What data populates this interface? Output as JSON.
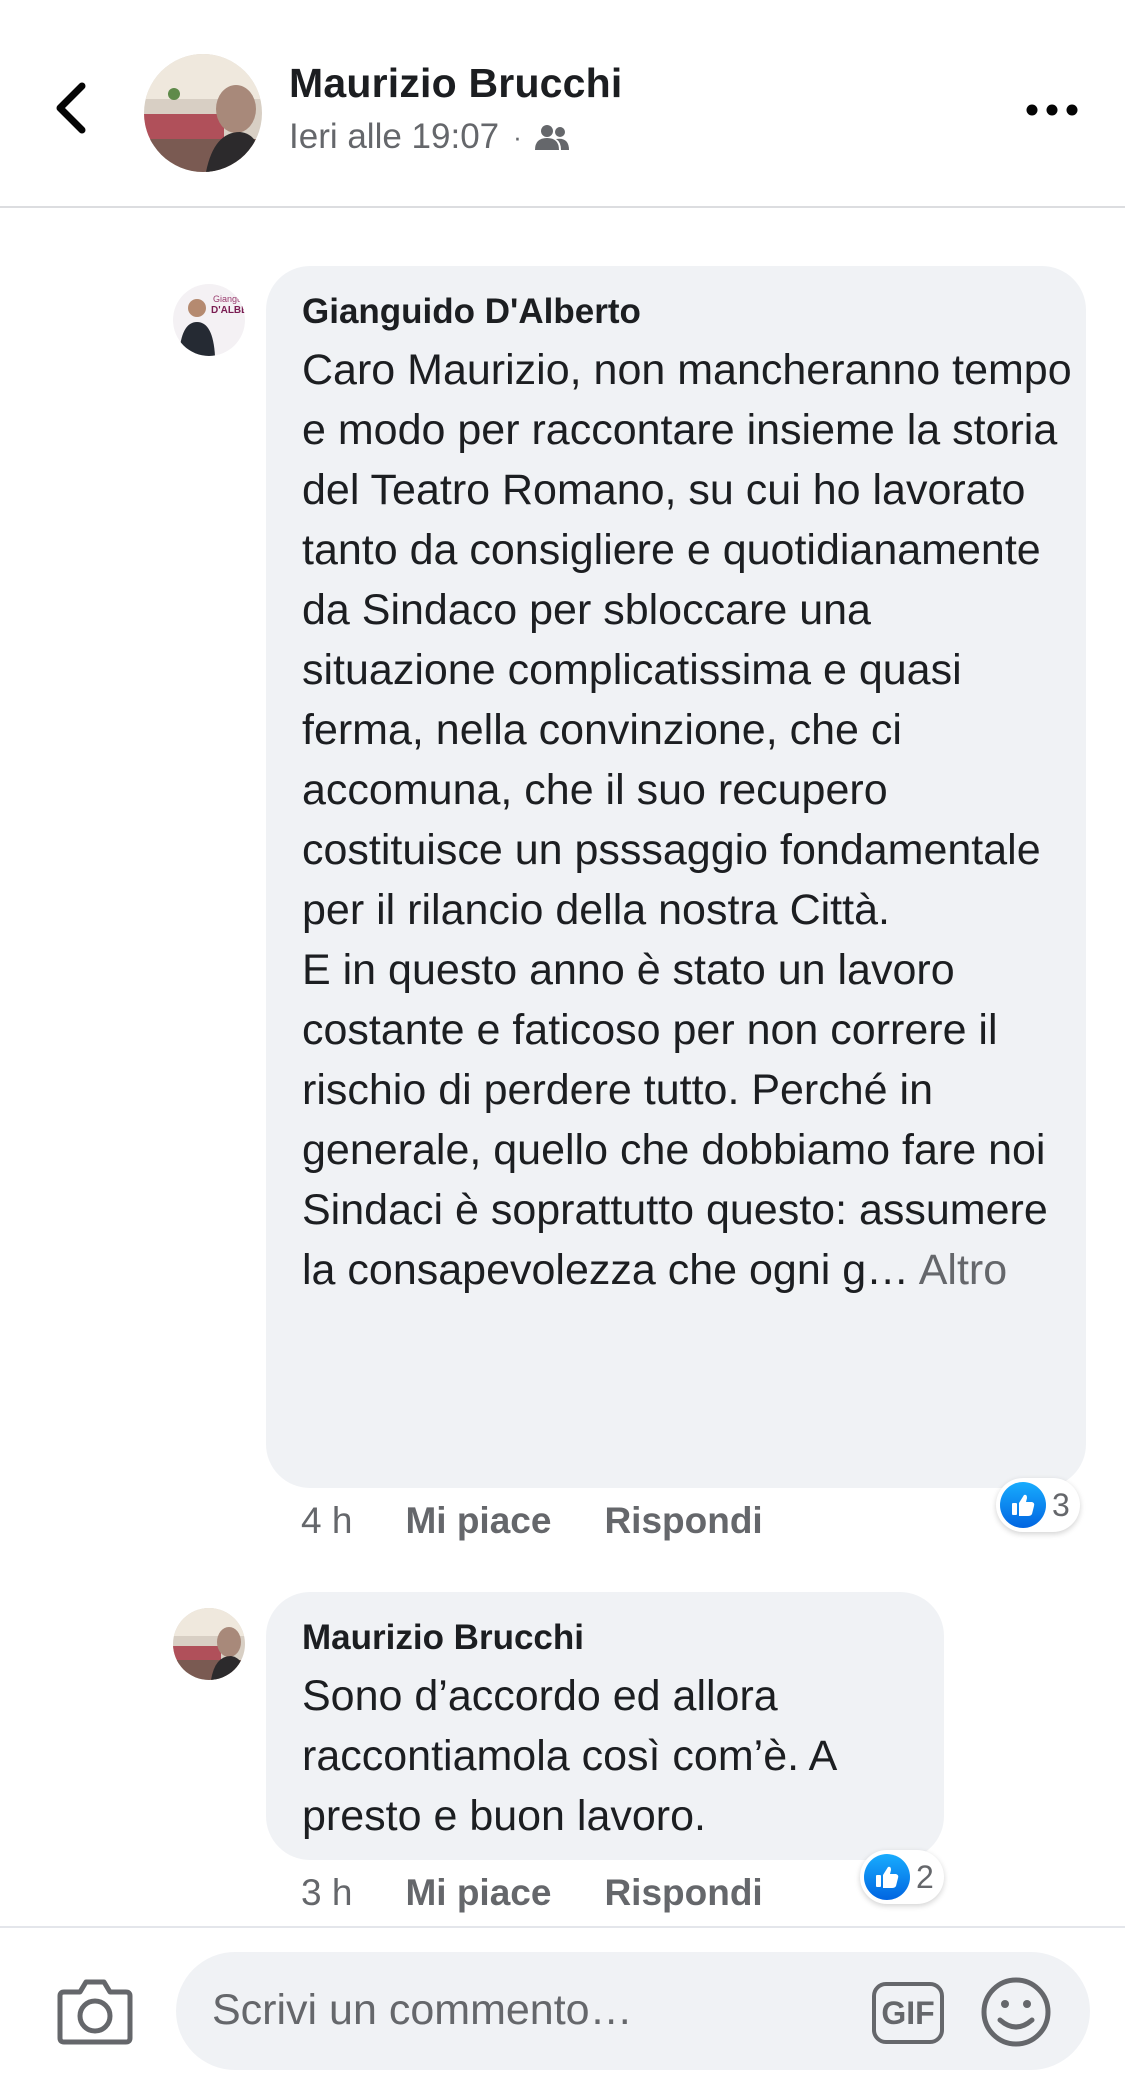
{
  "header": {
    "author_name": "Maurizio Brucchi",
    "timestamp": "Ieri alle 19:07",
    "separator": "·",
    "audience_icon": "friends-icon",
    "back_icon": "chevron-left-icon",
    "more_icon": "more-horizontal-icon"
  },
  "comments": [
    {
      "author": "Gianguido D'Alberto",
      "text": "Caro Maurizio, non mancheranno tempo e modo per raccontare insieme la storia del Teatro Romano, su cui ho lavorato tanto da consigliere e quotidianamente da Sindaco per sbloccare una situazione complicatissima e quasi ferma, nella convinzione, che ci accomuna, che il suo recupero costituisce un psssaggio fondamentale per il rilancio della nostra Città.\nE in questo anno è stato un lavoro costante e faticoso per non correre il rischio di perdere tutto. Perché in generale, quello che dobbiamo fare noi Sindaci è soprattutto questo: assumere la consapevolezza che ogni g…",
      "more_label": "Altro",
      "time": "4 h",
      "like_label": "Mi piace",
      "reply_label": "Rispondi",
      "reaction_count": "3"
    },
    {
      "author": "Maurizio Brucchi",
      "text": "Sono d’accordo ed allora raccontiamola così com’è. A presto e buon lavoro.",
      "time": "3 h",
      "like_label": "Mi piace",
      "reply_label": "Rispondi",
      "reaction_count": "2"
    }
  ],
  "composer": {
    "placeholder": "Scrivi un commento…",
    "gif_label": "GIF",
    "camera_icon": "camera-icon",
    "emoji_icon": "smiley-icon"
  },
  "colors": {
    "bubble": "#f0f2f5",
    "secondary_text": "#65676b",
    "like_blue": "#1877f2"
  }
}
